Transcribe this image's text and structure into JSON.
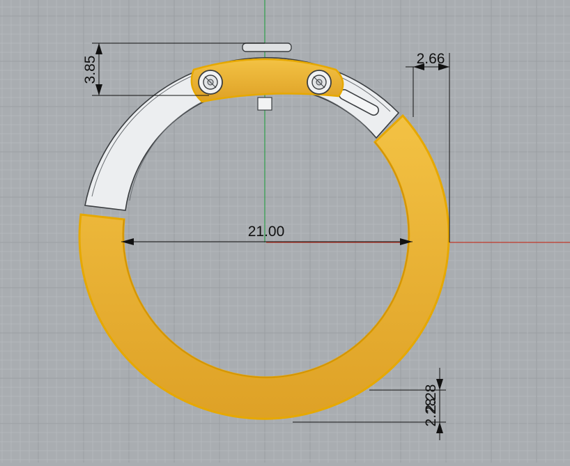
{
  "viewport": {
    "name": "cad-top-viewport",
    "background": "#a9adb1",
    "grid_minor_color": "#b6babe",
    "grid_major_color": "#9a9ea2",
    "axis_x_color": "#c0392b",
    "axis_y_color": "#2e9e4a"
  },
  "model": {
    "ring_fill": "#f0b429",
    "ring_fill_dark": "#d99a1c",
    "ring_outline": "#e6a800",
    "clasp_fill": "#eceef0",
    "clasp_outline": "#3a3d40"
  },
  "dimensions": {
    "top_height": "3.85",
    "side_width": "2.66",
    "inner_diameter": "21.00",
    "band_upper": "2.28",
    "band_lower": "2.28"
  }
}
